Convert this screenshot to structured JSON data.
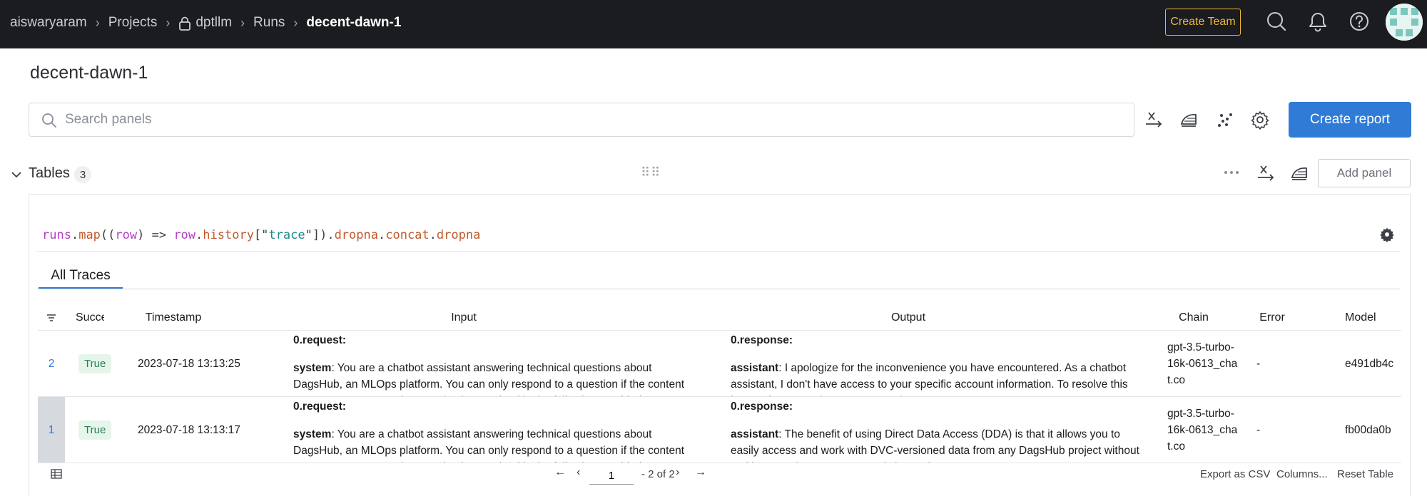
{
  "topbar": {
    "breadcrumbs": [
      "aiswaryaram",
      "Projects",
      "dptllm",
      "Runs",
      "decent-dawn-1"
    ],
    "create_team_label": "Create Team"
  },
  "page": {
    "run_title": "decent-dawn-1",
    "search_placeholder": "Search panels",
    "create_report_label": "Create report"
  },
  "section": {
    "title": "Tables",
    "count": "3",
    "add_panel_label": "Add panel"
  },
  "panel": {
    "expression": {
      "p1": "runs",
      "p2": ".",
      "p3": "map",
      "p4": "((",
      "p5": "row",
      "p6": ") => ",
      "p7": "row",
      "p8": ".",
      "p9": "history",
      "p10": "[\"",
      "p11": "trace",
      "p12": "\"]).",
      "p13": "dropna",
      "p14": ".",
      "p15": "concat",
      "p16": ".",
      "p17": "dropna"
    },
    "tab_label": "All Traces"
  },
  "table": {
    "columns": [
      "Succe",
      "Timestamp",
      "Input",
      "Output",
      "Chain",
      "Error",
      "Model"
    ],
    "rows": [
      {
        "index": "2",
        "success": "True",
        "timestamp": "2023-07-18 13:13:25",
        "input_head": "0.request:",
        "input_role": "system",
        "input_text": ": You are a chatbot assistant answering technical questions about DagsHub, an MLOps platform. You can only respond to a question if the content necessary to answer the question is contained in the following provided documentation.",
        "output_head": "0.response:",
        "output_role": "assistant",
        "output_text": ": I apologize for the inconvenience you have encountered. As a chatbot assistant, I don't have access to your specific account information. To resolve this issue, please reach out to DagsHub support.",
        "chain": "gpt-3.5-turbo-16k-0613_chat.co",
        "error": "-",
        "model": "e491db4c"
      },
      {
        "index": "1",
        "success": "True",
        "timestamp": "2023-07-18 13:13:17",
        "input_head": "0.request:",
        "input_role": "system",
        "input_text": ": You are a chatbot assistant answering technical questions about DagsHub, an MLOps platform. You can only respond to a question if the content necessary to answer the question is contained in the following provided documentation.",
        "output_head": "0.response:",
        "output_role": "assistant",
        "output_text": ": The benefit of using Direct Data Access (DDA) is that it allows you to easily access and work with DVC-versioned data from any DagsHub project without making any changes to your existing code.",
        "chain": "gpt-3.5-turbo-16k-0613_chat.co",
        "error": "-",
        "model": "fb00da0b"
      }
    ]
  },
  "footer": {
    "page_value": "1",
    "page_of": "- 2 of 2",
    "export_label": "Export as CSV",
    "columns_label": "Columns...",
    "reset_label": "Reset Table"
  },
  "colors": {
    "topbar_bg": "#1a1c1f",
    "accent_blue": "#2f7bd6",
    "create_team_gold": "#f0b43c",
    "success_green": "#2e7d4f"
  },
  "icons": [
    "lock-icon",
    "search-icon",
    "bell-icon",
    "help-icon",
    "x-axis-icon",
    "smoothing-icon",
    "outliers-icon",
    "gear-icon",
    "chevron-down-icon",
    "more-icon",
    "filter-icon",
    "table-icon"
  ]
}
